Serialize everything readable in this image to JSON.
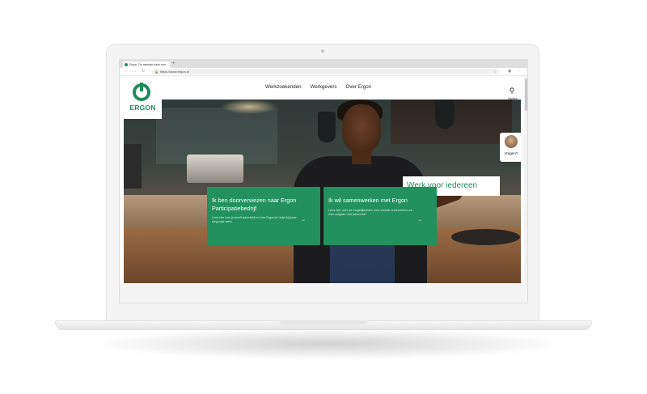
{
  "browser": {
    "tab_title": "Ergon: De centrale bank voor ...",
    "new_tab": "+",
    "url": "https://www.ergon.nl",
    "icons": [
      "back-icon",
      "forward-icon",
      "reload-icon",
      "lock-icon",
      "star-icon",
      "profile-icon",
      "more-icon"
    ]
  },
  "site": {
    "logo_text": "ERGON",
    "nav": [
      "Werkzoekenden",
      "Werkgevers",
      "Over Ergon"
    ],
    "search_label": "Zoeken",
    "hero_title": "Werk voor iedereen",
    "help_label": "Vragen?",
    "accent": "#1e8b58",
    "cards": [
      {
        "title": "Ik ben doorverwezen naar Ergon Participatiebedrijf",
        "text": "Lees hier hoe je jezelf aanmeldt en hoe Ergon je helpt bij jouw weg naar werk"
      },
      {
        "title": "Ik wil samenwerken met Ergon",
        "text": "Lees hier over de mogelijkheden voor sociaal ondernemen en slim omgaan met personeel"
      }
    ]
  }
}
